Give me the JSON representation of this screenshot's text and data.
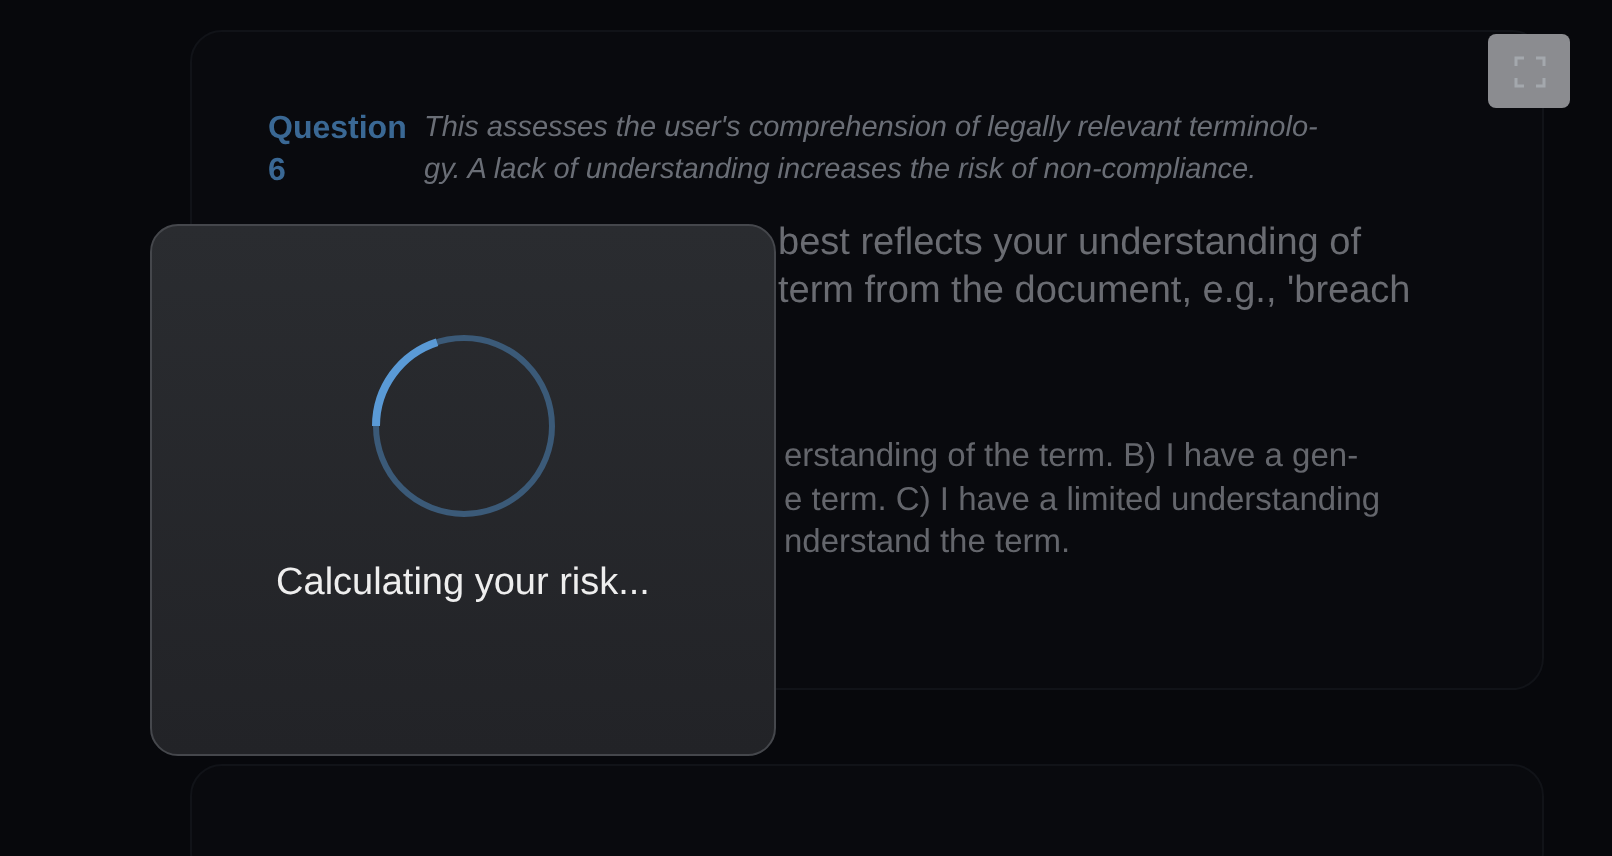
{
  "question_card": {
    "label": "Question 6",
    "description_lines": [
      "This assesses the user's comprehension of legally relevant terminolo-",
      "gy. A lack of understanding increases the risk of non-compliance."
    ],
    "question_lines": [
      "best reflects your understanding of",
      "term from the document, e.g., 'breach"
    ],
    "option_lines": [
      "erstanding of the term. B) I have a gen-",
      "e term. C) I have a limited understanding",
      "nderstand the term."
    ]
  },
  "loading_dialog": {
    "message": "Calculating your risk...",
    "level": 0.2
  }
}
